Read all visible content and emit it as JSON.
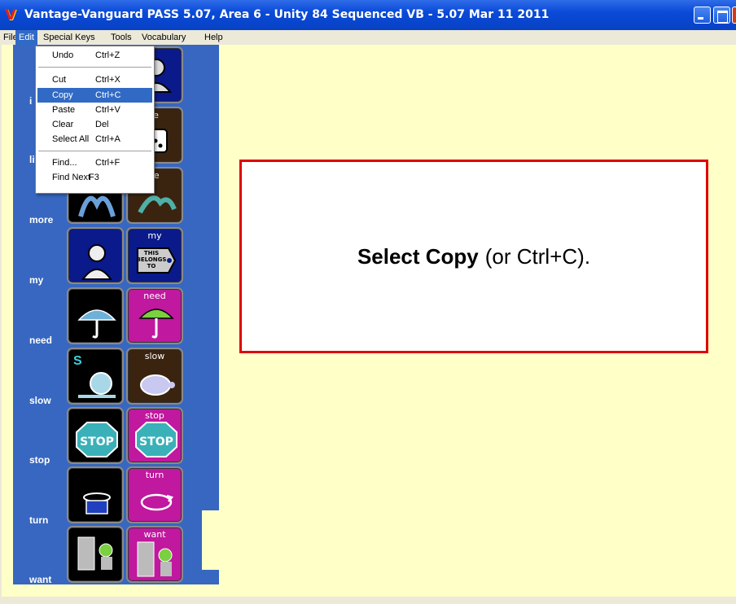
{
  "window": {
    "title": "Vantage-Vanguard PASS 5.07, Area 6 - Unity 84 Sequenced VB - 5.07 Mar 11 2011",
    "logo": "V",
    "controls": [
      "minimize-icon",
      "maximize-icon",
      "close-icon"
    ]
  },
  "menubar": {
    "items": [
      "File",
      "Edit",
      "Special Keys",
      "Tools",
      "Vocabulary",
      "Help"
    ],
    "active": "Edit"
  },
  "edit_menu": {
    "items": [
      {
        "label": "Undo",
        "shortcut": "Ctrl+Z"
      },
      {
        "label": "Cut",
        "shortcut": "Ctrl+X"
      },
      {
        "label": "Copy",
        "shortcut": "Ctrl+C",
        "highlighted": true
      },
      {
        "label": "Paste",
        "shortcut": "Ctrl+V"
      },
      {
        "label": "Clear",
        "shortcut": "Del"
      },
      {
        "label": "Select All",
        "shortcut": "Ctrl+A"
      },
      {
        "label": "Find...",
        "shortcut": "Ctrl+F"
      },
      {
        "label": "Find Next",
        "shortcut": "F3"
      }
    ]
  },
  "word_list": [
    "i",
    "littl",
    "more",
    "my",
    "need",
    "slow",
    "stop",
    "turn",
    "want"
  ],
  "keys": {
    "le": "le",
    "re": "re",
    "my": "my",
    "belongs": "THIS BELONGS TO",
    "need": "need",
    "slow": "slow",
    "stop": "stop",
    "stop_sign": "STOP",
    "turn": "turn",
    "want": "want",
    "snail_letter": "S"
  },
  "instruction": {
    "bold": "Select Copy",
    "rest": "(or Ctrl+C)."
  },
  "colors": {
    "titlebar": "#0a4ad8",
    "menu_highlight": "#316ac5",
    "word_panel": "#3767c0",
    "canvas": "#ffffc8",
    "instruction_border": "#e00000",
    "key_magenta": "#c0189e"
  }
}
